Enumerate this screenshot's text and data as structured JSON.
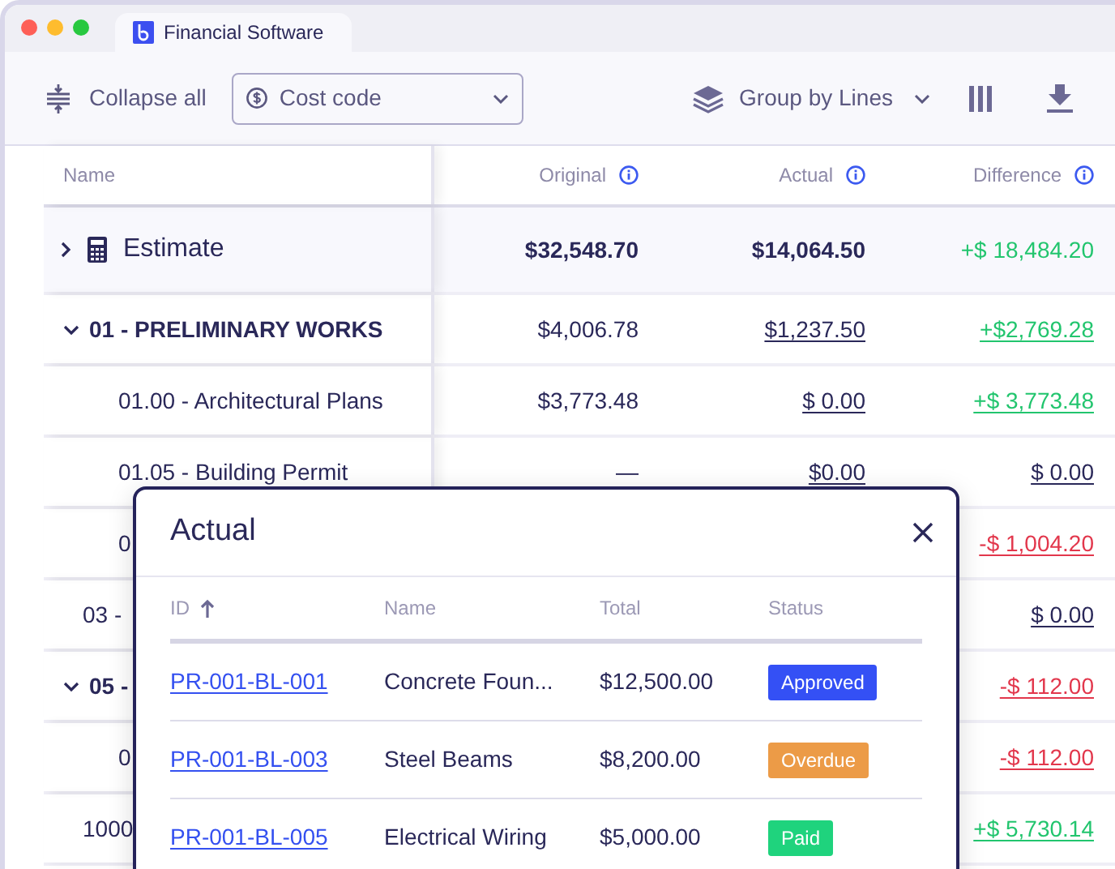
{
  "window": {
    "tab_title": "Financial Software"
  },
  "toolbar": {
    "collapse_label": "Collapse all",
    "cost_code": {
      "value": "Cost code"
    },
    "group_by": "Group by Lines"
  },
  "table": {
    "columns": [
      {
        "label": "Name",
        "info": false
      },
      {
        "label": "Original",
        "info": true
      },
      {
        "label": "Actual",
        "info": true
      },
      {
        "label": "Difference",
        "info": true
      }
    ],
    "rows": [
      {
        "kind": "estimate",
        "name": "Estimate",
        "expanded": false,
        "original": "$32,548.70",
        "actual": "$14,064.50",
        "difference": "+$ 18,484.20",
        "color": "#22c56e"
      },
      {
        "kind": "group",
        "name": "01 - PRELIMINARY WORKS",
        "expanded": true,
        "original": "$4,006.78",
        "actual": "$1,237.50",
        "difference": "+$2,769.28",
        "color": "#22c56e"
      },
      {
        "kind": "item",
        "name": "01.00 - Architectural Plans",
        "original": "$3,773.48",
        "actual": "$ 0.00",
        "difference": "+$ 3,773.48",
        "color": "#22c56e"
      },
      {
        "kind": "item",
        "name": "01.05 - Building Permit",
        "original": "—",
        "actual": "$0.00",
        "difference": "$ 0.00",
        "color": "#2a2859"
      },
      {
        "kind": "item",
        "name": "0",
        "difference": "-$ 1,004.20",
        "color": "#e2374c"
      },
      {
        "kind": "line",
        "name": "03 -",
        "difference": "$ 0.00",
        "color": "#2a2859"
      },
      {
        "kind": "group",
        "name": "05 -",
        "expanded": true,
        "difference": "-$ 112.00",
        "color": "#e2374c"
      },
      {
        "kind": "item",
        "name": "0",
        "difference": "-$ 112.00",
        "color": "#e2374c"
      },
      {
        "kind": "line",
        "name": "1000",
        "difference": "+$ 5,730.14",
        "color": "#22c56e"
      }
    ]
  },
  "modal": {
    "title": "Actual",
    "columns": [
      {
        "label": "ID",
        "sorted": true
      },
      {
        "label": "Name",
        "sorted": false
      },
      {
        "label": "Total",
        "sorted": false
      },
      {
        "label": "Status",
        "sorted": false
      }
    ],
    "rows": [
      {
        "id": "PR-001-BL-001",
        "name": "Concrete Foun...",
        "total": "$12,500.00",
        "status": "Approved",
        "color": "#3450f5"
      },
      {
        "id": "PR-001-BL-003",
        "name": "Steel Beams",
        "total": "$8,200.00",
        "status": "Overdue",
        "color": "#ec9b47"
      },
      {
        "id": "PR-001-BL-005",
        "name": "Electrical Wiring",
        "total": "$5,000.00",
        "status": "Paid",
        "color": "#1fd37d"
      }
    ]
  }
}
